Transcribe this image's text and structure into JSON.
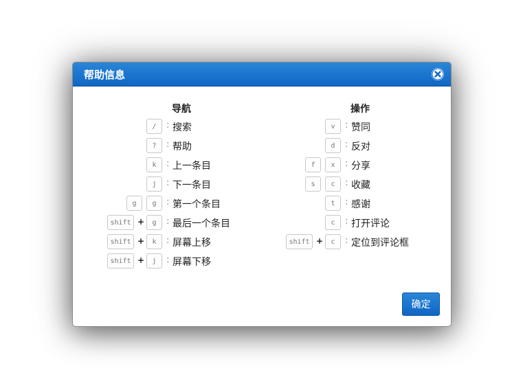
{
  "dialog": {
    "title": "帮助信息",
    "ok_label": "确定",
    "accent_color": "#1470cc"
  },
  "nav": {
    "title": "导航",
    "items": [
      {
        "keys": [
          "/"
        ],
        "sep": [],
        "label": "搜索"
      },
      {
        "keys": [
          "?"
        ],
        "sep": [],
        "label": "帮助"
      },
      {
        "keys": [
          "k"
        ],
        "sep": [],
        "label": "上一条目"
      },
      {
        "keys": [
          "j"
        ],
        "sep": [],
        "label": "下一条目"
      },
      {
        "keys": [
          "g",
          "g"
        ],
        "sep": [
          ""
        ],
        "label": "第一个条目"
      },
      {
        "keys": [
          "shift",
          "g"
        ],
        "sep": [
          "+"
        ],
        "label": "最后一个条目"
      },
      {
        "keys": [
          "shift",
          "k"
        ],
        "sep": [
          "+"
        ],
        "label": "屏幕上移"
      },
      {
        "keys": [
          "shift",
          "j"
        ],
        "sep": [
          "+"
        ],
        "label": "屏幕下移"
      }
    ]
  },
  "ops": {
    "title": "操作",
    "items": [
      {
        "keys": [
          "v"
        ],
        "sep": [],
        "label": "赞同"
      },
      {
        "keys": [
          "d"
        ],
        "sep": [],
        "label": "反对"
      },
      {
        "keys": [
          "f",
          "x"
        ],
        "sep": [
          ""
        ],
        "label": "分享"
      },
      {
        "keys": [
          "s",
          "c"
        ],
        "sep": [
          ""
        ],
        "label": "收藏"
      },
      {
        "keys": [
          "t"
        ],
        "sep": [],
        "label": "感谢"
      },
      {
        "keys": [
          "c"
        ],
        "sep": [],
        "label": "打开评论"
      },
      {
        "keys": [
          "shift",
          "c"
        ],
        "sep": [
          "+"
        ],
        "label": "定位到评论框"
      }
    ]
  },
  "colon": ":"
}
